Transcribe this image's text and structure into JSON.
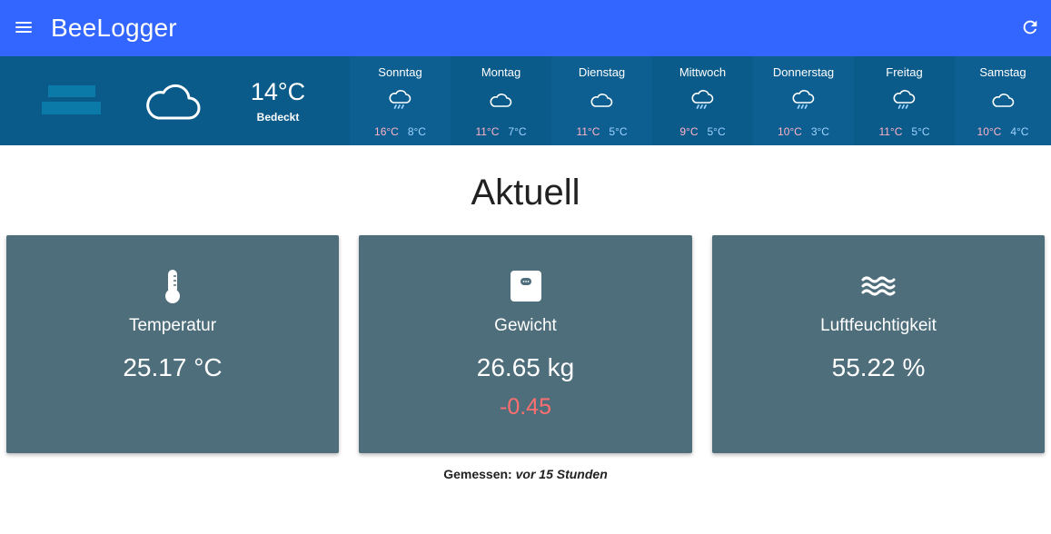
{
  "app": {
    "title": "BeeLogger",
    "colors": {
      "appbar": "#3366ff",
      "weather": "#0a5a8a",
      "card": "#4f6e7b",
      "negative": "#ff6f6f"
    }
  },
  "weather": {
    "today": {
      "temp": "14°C",
      "condition": "Bedeckt",
      "icon": "cloud-icon"
    },
    "days": [
      {
        "name": "Sonntag",
        "high": "16°C",
        "low": "8°C",
        "icon": "cloud-rain-icon"
      },
      {
        "name": "Montag",
        "high": "11°C",
        "low": "7°C",
        "icon": "cloud-icon"
      },
      {
        "name": "Dienstag",
        "high": "11°C",
        "low": "5°C",
        "icon": "cloud-icon"
      },
      {
        "name": "Mittwoch",
        "high": "9°C",
        "low": "5°C",
        "icon": "cloud-rain-icon"
      },
      {
        "name": "Donnerstag",
        "high": "10°C",
        "low": "3°C",
        "icon": "cloud-rain-icon"
      },
      {
        "name": "Freitag",
        "high": "11°C",
        "low": "5°C",
        "icon": "cloud-rain-icon"
      },
      {
        "name": "Samstag",
        "high": "10°C",
        "low": "4°C",
        "icon": "cloud-icon"
      }
    ]
  },
  "main": {
    "heading": "Aktuell",
    "cards": [
      {
        "label": "Temperatur",
        "value": "25.17 °C",
        "icon": "thermometer-icon"
      },
      {
        "label": "Gewicht",
        "value": "26.65 kg",
        "delta": "-0.45",
        "icon": "scale-icon"
      },
      {
        "label": "Luftfeuchtigkeit",
        "value": "55.22 %",
        "icon": "water-waves-icon"
      }
    ],
    "measured": {
      "label": "Gemessen:",
      "value": "vor 15 Stunden"
    }
  }
}
